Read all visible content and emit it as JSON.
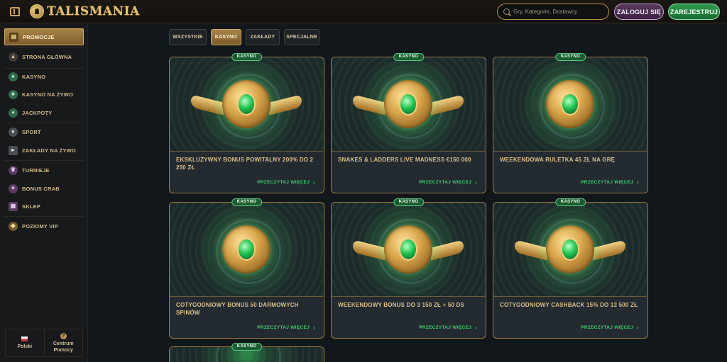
{
  "header": {
    "logo_text": "TALISMANIA",
    "search_placeholder": "Gry, Kategorie, Dostawcy",
    "login_label": "ZALOGUJ SIĘ",
    "register_label": "ZAREJESTRUJ"
  },
  "sidebar": {
    "items": [
      {
        "label": "PROMOCJE",
        "icon": "promo-icon",
        "active": true
      },
      {
        "label": "STRONA GŁÓWNA",
        "icon": "home-icon"
      },
      {
        "label": "KASYNO",
        "icon": "casino-icon"
      },
      {
        "label": "KASYNO NA ŻYWO",
        "icon": "live-casino-icon"
      },
      {
        "label": "JACKPOTY",
        "icon": "jackpot-icon"
      },
      {
        "label": "SPORT",
        "icon": "sport-icon"
      },
      {
        "label": "ZAKŁADY NA ŻYWO",
        "icon": "live-bets-icon"
      },
      {
        "label": "TURNIEJE",
        "icon": "trophy-icon"
      },
      {
        "label": "BONUS CRAB",
        "icon": "crab-icon"
      },
      {
        "label": "SKLEP",
        "icon": "shop-icon"
      },
      {
        "label": "POZIOMY VIP",
        "icon": "vip-icon"
      }
    ],
    "footer": {
      "language": "Polski",
      "help_line1": "Centrum",
      "help_line2": "Pomocy"
    }
  },
  "tabs": [
    {
      "label": "WSZYSTKIE",
      "active": false
    },
    {
      "label": "KASYNO",
      "active": true
    },
    {
      "label": "ZAKŁADY",
      "active": false
    },
    {
      "label": "SPECJALNE",
      "active": false
    }
  ],
  "cards": [
    {
      "badge": "KASYNO",
      "title": "EKSKLUZYWNY BONUS POWITALNY 200% DO 2 250 ZŁ",
      "link": "PRZECZYTAJ WIĘCEJ",
      "art": "scarab-emblem"
    },
    {
      "badge": "KASYNO",
      "title": "SNAKES & LADDERS LIVE MADNESS €150 000",
      "link": "PRZECZYTAJ WIĘCEJ",
      "art": "winged-ankh"
    },
    {
      "badge": "KASYNO",
      "title": "WEEKENDOWA RULETKA 45 ZŁ NA GRĘ",
      "link": "PRZECZYTAJ WIĘCEJ",
      "art": "eye-of-horus"
    },
    {
      "badge": "KASYNO",
      "title": "COTYGODNIOWY BONUS 50 DARMOWYCH SPINÓW",
      "link": "PRZECZYTAJ WIĘCEJ",
      "art": "horus-falcon"
    },
    {
      "badge": "KASYNO",
      "title": "WEEKENDOWY BONUS DO 3 150 ZŁ + 50 DS",
      "link": "PRZECZYTAJ WIĘCEJ",
      "art": "winged-cobra"
    },
    {
      "badge": "KASYNO",
      "title": "COTYGODNIOWY CASHBACK 15% DO 13 500 ZŁ",
      "link": "PRZECZYTAJ WIĘCEJ",
      "art": "winged-ankh"
    },
    {
      "badge": "KASYNO",
      "title": "",
      "link": "",
      "art": "partial"
    }
  ],
  "colors": {
    "accent_gold": "#c9a25a",
    "accent_green": "#3fd06c",
    "background": "#12171b"
  }
}
